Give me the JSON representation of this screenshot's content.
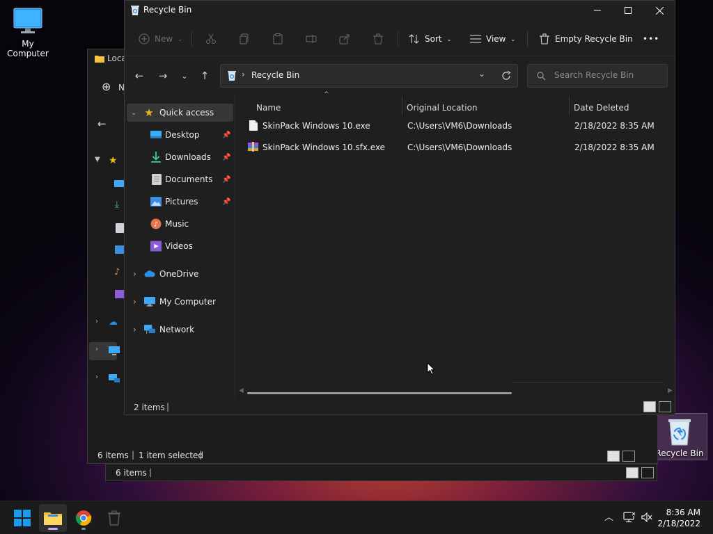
{
  "desktop": {
    "icons": [
      {
        "label": "My Computer"
      },
      {
        "label": "Recycle Bin"
      }
    ]
  },
  "back_window": {
    "title": "Loca",
    "new_label": "N",
    "status_items": "6 items",
    "status_selected": "1 item selected"
  },
  "back_window2": {
    "status_items": "6 items"
  },
  "window": {
    "title": "Recycle Bin",
    "toolbar": {
      "new_label": "New",
      "sort_label": "Sort",
      "view_label": "View",
      "empty_label": "Empty Recycle Bin",
      "more_label": "•••"
    },
    "address": {
      "crumb_sep": "›",
      "path": "Recycle Bin"
    },
    "search": {
      "placeholder": "Search Recycle Bin"
    },
    "sidebar": {
      "quick_access": "Quick access",
      "items": [
        {
          "label": "Desktop",
          "icon": "desktop-icon",
          "pinned": true
        },
        {
          "label": "Downloads",
          "icon": "download-icon",
          "pinned": true
        },
        {
          "label": "Documents",
          "icon": "document-icon",
          "pinned": true
        },
        {
          "label": "Pictures",
          "icon": "picture-icon",
          "pinned": true
        },
        {
          "label": "Music",
          "icon": "music-icon",
          "pinned": false
        },
        {
          "label": "Videos",
          "icon": "video-icon",
          "pinned": false
        }
      ],
      "roots": [
        {
          "label": "OneDrive",
          "icon": "cloud-icon"
        },
        {
          "label": "My Computer",
          "icon": "computer-icon"
        },
        {
          "label": "Network",
          "icon": "network-icon"
        }
      ]
    },
    "columns": {
      "name": "Name",
      "original_location": "Original Location",
      "date_deleted": "Date Deleted"
    },
    "files": [
      {
        "name": "SkinPack Windows 10.exe",
        "location": "C:\\Users\\VM6\\Downloads",
        "date": "2/18/2022 8:35 AM",
        "icon": "exe-file-icon"
      },
      {
        "name": "SkinPack Windows 10.sfx.exe",
        "location": "C:\\Users\\VM6\\Downloads",
        "date": "2/18/2022 8:35 AM",
        "icon": "archive-file-icon"
      }
    ],
    "status": {
      "items": "2 items"
    }
  },
  "taskbar": {
    "clock_time": "8:36 AM",
    "clock_date": "2/18/2022"
  },
  "colors": {
    "accent_start": "#0078d4",
    "folder_yellow": "#f5c342",
    "star_yellow": "#f2b51d"
  }
}
